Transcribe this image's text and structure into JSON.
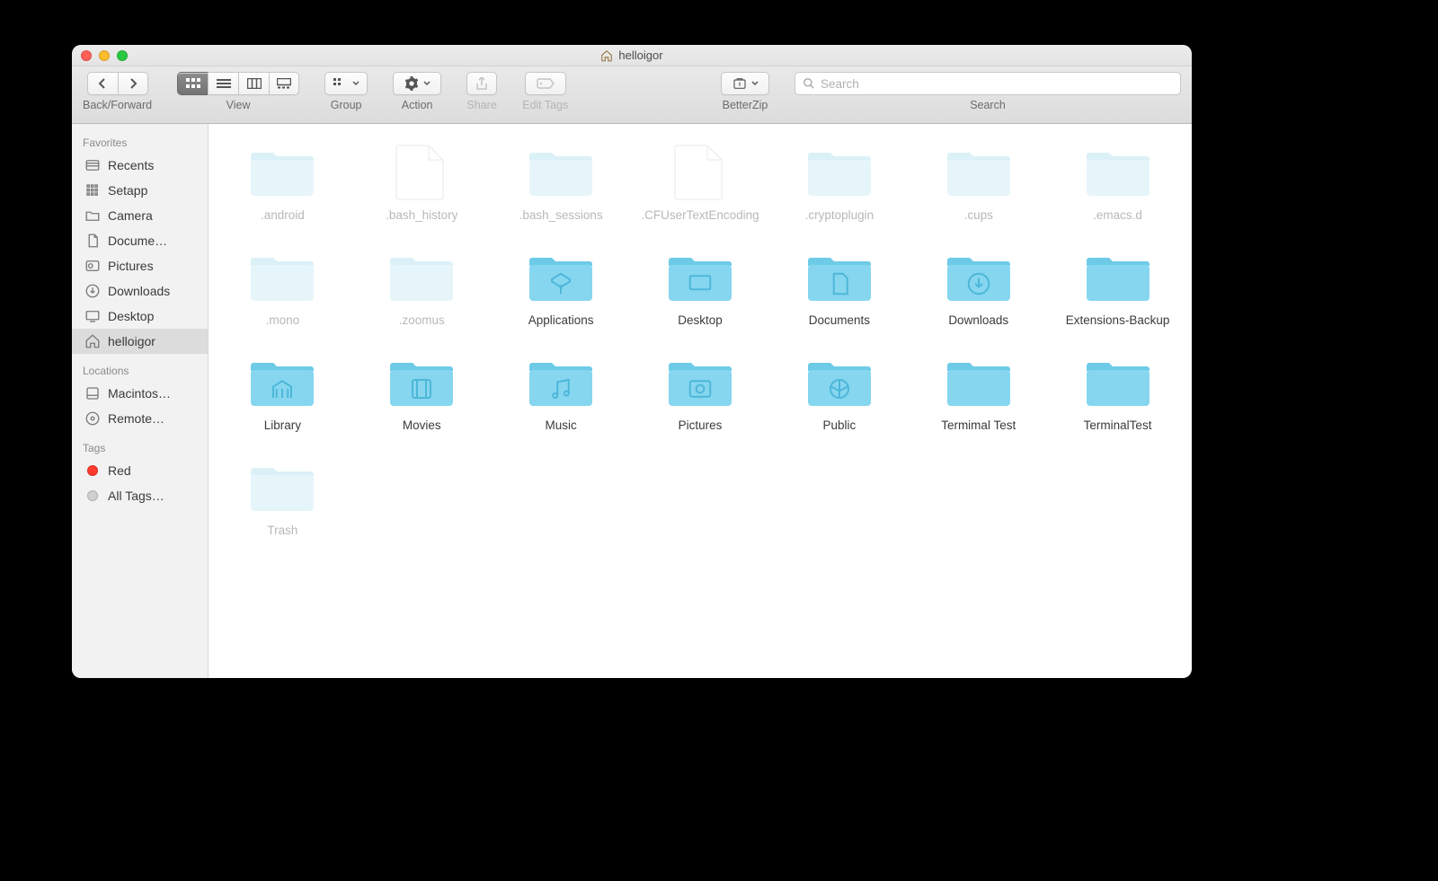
{
  "window": {
    "title": "helloigor"
  },
  "toolbar": {
    "back_forward": "Back/Forward",
    "view": "View",
    "group": "Group",
    "action": "Action",
    "share": "Share",
    "edit_tags": "Edit Tags",
    "betterzip": "BetterZip",
    "search_label": "Search",
    "search_placeholder": "Search"
  },
  "sidebar": {
    "favorites_head": "Favorites",
    "locations_head": "Locations",
    "tags_head": "Tags",
    "favorites": [
      {
        "label": "Recents",
        "icon": "recents"
      },
      {
        "label": "Setapp",
        "icon": "setapp"
      },
      {
        "label": "Camera",
        "icon": "folder"
      },
      {
        "label": "Docume…",
        "icon": "documents"
      },
      {
        "label": "Pictures",
        "icon": "pictures"
      },
      {
        "label": "Downloads",
        "icon": "downloads"
      },
      {
        "label": "Desktop",
        "icon": "desktop"
      },
      {
        "label": "helloigor",
        "icon": "home",
        "selected": true
      }
    ],
    "locations": [
      {
        "label": "Macintos…",
        "icon": "disk"
      },
      {
        "label": "Remote…",
        "icon": "disc"
      }
    ],
    "tags": [
      {
        "label": "Red",
        "color": "#ff3b30"
      },
      {
        "label": "All Tags…",
        "color": "#d0d0d0"
      }
    ]
  },
  "items": [
    {
      "name": ".android",
      "type": "folder",
      "hidden": true
    },
    {
      "name": ".bash_history",
      "type": "file",
      "hidden": true
    },
    {
      "name": ".bash_sessions",
      "type": "folder",
      "hidden": true
    },
    {
      "name": ".CFUserTextEncoding",
      "type": "file",
      "hidden": true
    },
    {
      "name": ".cryptoplugin",
      "type": "folder",
      "hidden": true
    },
    {
      "name": ".cups",
      "type": "folder",
      "hidden": true
    },
    {
      "name": ".emacs.d",
      "type": "folder",
      "hidden": true
    },
    {
      "name": ".mono",
      "type": "folder",
      "hidden": true
    },
    {
      "name": ".zoomus",
      "type": "folder",
      "hidden": true
    },
    {
      "name": "Applications",
      "type": "folder",
      "glyph": "apps"
    },
    {
      "name": "Desktop",
      "type": "folder",
      "glyph": "desktop"
    },
    {
      "name": "Documents",
      "type": "folder",
      "glyph": "documents"
    },
    {
      "name": "Downloads",
      "type": "folder",
      "glyph": "downloads"
    },
    {
      "name": "Extensions-Backup",
      "type": "folder"
    },
    {
      "name": "Library",
      "type": "folder",
      "glyph": "library"
    },
    {
      "name": "Movies",
      "type": "folder",
      "glyph": "movies"
    },
    {
      "name": "Music",
      "type": "folder",
      "glyph": "music"
    },
    {
      "name": "Pictures",
      "type": "folder",
      "glyph": "pictures"
    },
    {
      "name": "Public",
      "type": "folder",
      "glyph": "public"
    },
    {
      "name": "Termimal Test",
      "type": "folder"
    },
    {
      "name": "TerminalTest",
      "type": "folder"
    },
    {
      "name": "Trash",
      "type": "folder",
      "hidden": true
    }
  ]
}
